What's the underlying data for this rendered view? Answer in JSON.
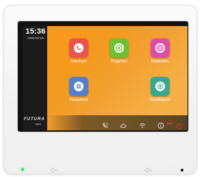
{
  "clock": {
    "time": "15:36",
    "date": "2022-03-19"
  },
  "brand": {
    "name": "FUTURA",
    "sub": "digital"
  },
  "apps": [
    {
      "label": "Interkom",
      "color": "#e9544d",
      "icon": "phone-icon"
    },
    {
      "label": "Rögzítés",
      "color": "#71c034",
      "icon": "record-icon"
    },
    {
      "label": "Kitekintés",
      "color": "#dc4fa8",
      "icon": "camera-view-icon"
    },
    {
      "label": "Hívásmód",
      "color": "#5580c9",
      "icon": "grid-icon"
    },
    {
      "label": "Beállítások",
      "color": "#38a98d",
      "icon": "gear-icon"
    }
  ],
  "status_icons": [
    "call-log-icon",
    "cloud-icon",
    "wifi-icon",
    "info-icon",
    "power-icon"
  ],
  "colors": {
    "screen_orange": "#f39a1e",
    "indicator_red": "#e0352c",
    "led_green": "#2ee06a"
  }
}
